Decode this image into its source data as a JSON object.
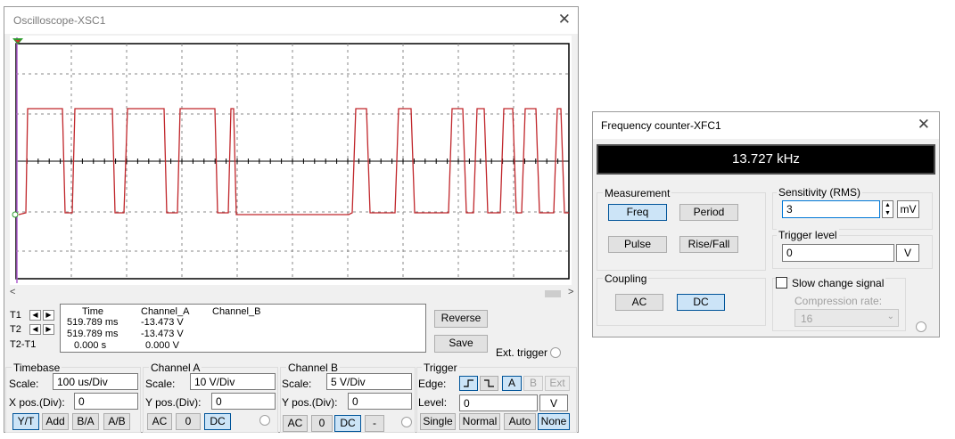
{
  "oscilloscope": {
    "title": "Oscilloscope-XSC1",
    "close_glyph": "✕",
    "trace_color": "#c0262b",
    "scroll_left": "<",
    "scroll_right": ">",
    "readout": {
      "t1_label": "T1",
      "t2_label": "T2",
      "t2t1_label": "T2-T1",
      "headers": [
        "Time",
        "Channel_A",
        "Channel_B"
      ],
      "rows": [
        [
          "519.789 ms",
          "-13.473 V",
          ""
        ],
        [
          "519.789 ms",
          "-13.473 V",
          ""
        ],
        [
          "0.000 s",
          "0.000 V",
          ""
        ]
      ]
    },
    "reverse_label": "Reverse",
    "save_label": "Save",
    "ext_trigger_label": "Ext. trigger",
    "timebase": {
      "title": "Timebase",
      "scale_label": "Scale:",
      "scale_value": "100 us/Div",
      "xpos_label": "X pos.(Div):",
      "xpos_value": "0",
      "buttons": [
        "Y/T",
        "Add",
        "B/A",
        "A/B"
      ]
    },
    "channel_a": {
      "title": "Channel A",
      "scale_label": "Scale:",
      "scale_value": "10  V/Div",
      "ypos_label": "Y pos.(Div):",
      "ypos_value": "0",
      "buttons": [
        "AC",
        "0",
        "DC"
      ]
    },
    "channel_b": {
      "title": "Channel B",
      "scale_label": "Scale:",
      "scale_value": "5  V/Div",
      "ypos_label": "Y pos.(Div):",
      "ypos_value": "0",
      "buttons": [
        "AC",
        "0",
        "DC",
        "-"
      ]
    },
    "trigger": {
      "title": "Trigger",
      "edge_label": "Edge:",
      "level_label": "Level:",
      "level_value": "0",
      "level_unit": "V",
      "edge_sources": [
        "A",
        "B",
        "Ext"
      ],
      "modes": [
        "Single",
        "Normal",
        "Auto",
        "None"
      ]
    }
  },
  "counter": {
    "title": "Frequency counter-XFC1",
    "close_glyph": "✕",
    "display_value": "13.727 kHz",
    "measurement": {
      "title": "Measurement",
      "buttons": [
        "Freq",
        "Period",
        "Pulse",
        "Rise/Fall"
      ]
    },
    "coupling": {
      "title": "Coupling",
      "buttons": [
        "AC",
        "DC"
      ]
    },
    "sensitivity": {
      "title": "Sensitivity (RMS)",
      "value": "3",
      "unit": "mV"
    },
    "trigger_level": {
      "title": "Trigger level",
      "value": "0",
      "unit": "V"
    },
    "slow_change": {
      "label": "Slow change signal",
      "compression_label": "Compression rate:",
      "compression_value": "16"
    }
  }
}
